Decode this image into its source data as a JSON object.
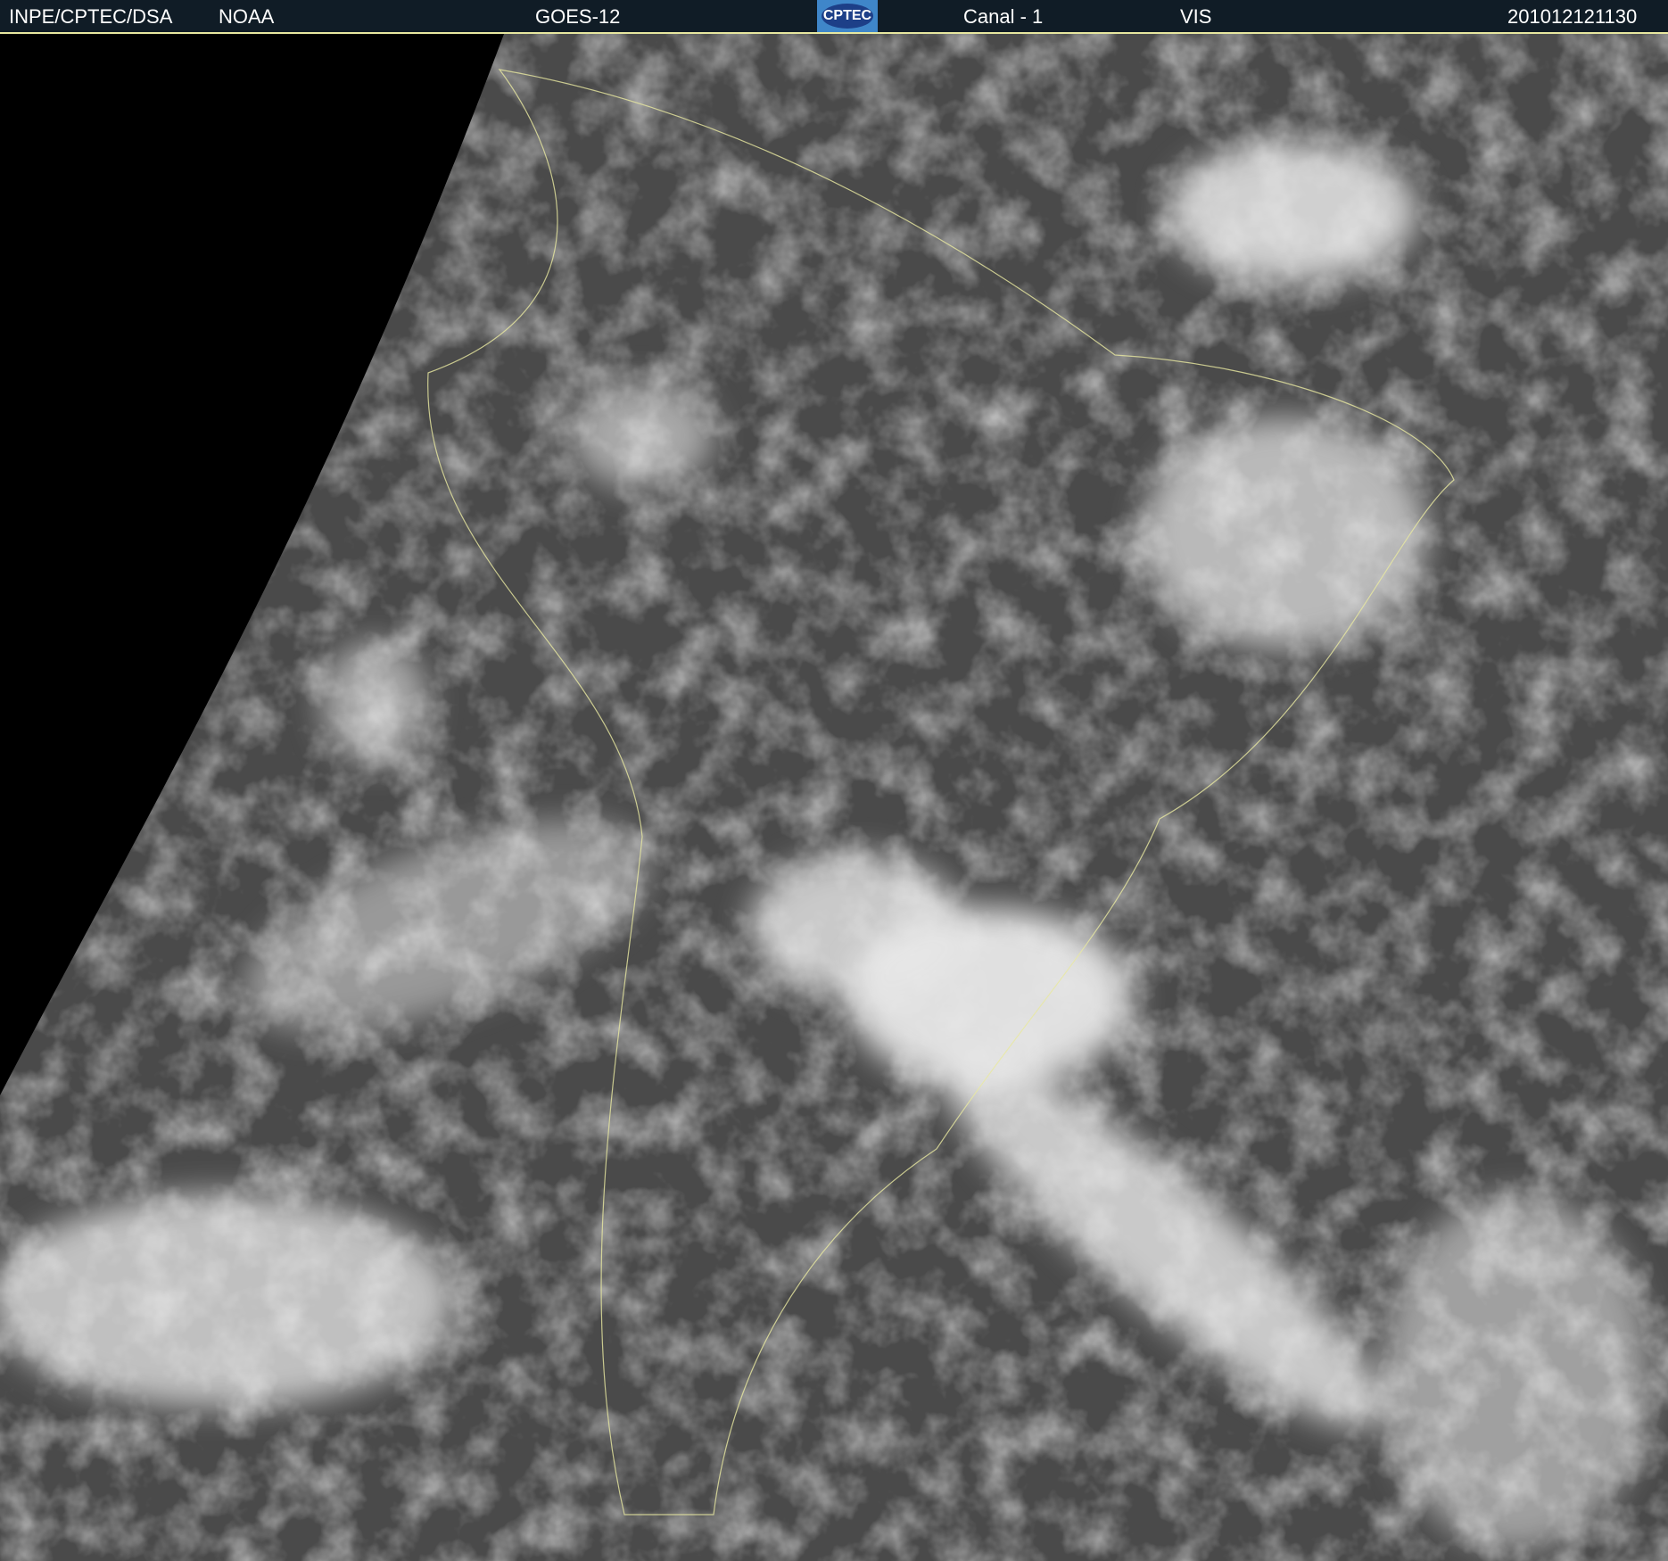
{
  "header": {
    "agency": "INPE/CPTEC/DSA",
    "source": "NOAA",
    "satellite": "GOES-12",
    "logo_text": "CPTEC",
    "channel": "Canal - 1",
    "band": "VIS",
    "timestamp": "201012121130"
  },
  "colors": {
    "header_bg": "#101c26",
    "border": "#e8e8a0",
    "logo_bg": "#3f86c9"
  }
}
